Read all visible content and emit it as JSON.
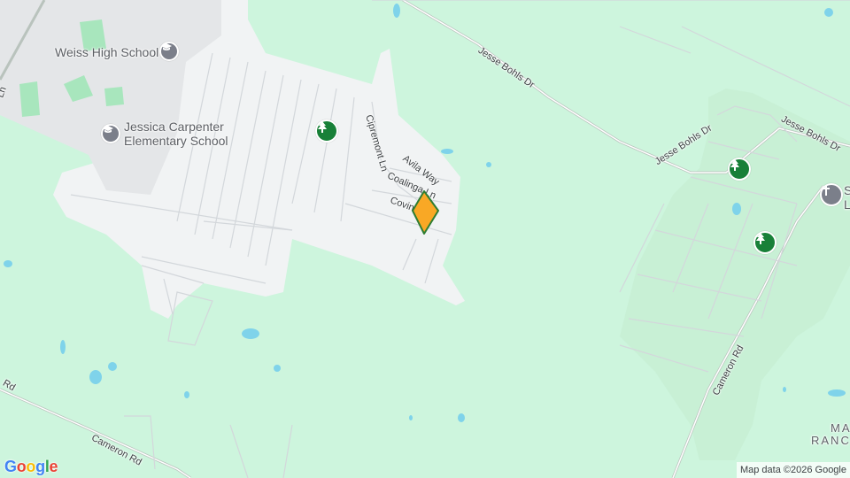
{
  "map": {
    "colors": {
      "land": "#cdf5dd",
      "urban": "#f1f3f4",
      "water": "#7fd3ea",
      "school": "#dadce0",
      "road": "#ffffff",
      "marker": "#f9a825"
    },
    "pois": {
      "weiss": "Weiss High School",
      "jessica_line1": "Jessica Carpenter",
      "jessica_line2": "Elementary School",
      "right_church": "S",
      "right_church2": "L"
    },
    "roads": {
      "jesse1": "Jesse Bohls Dr",
      "jesse2": "Jesse Bohls Dr",
      "jesse3": "Jesse Bohls Dr",
      "cipremont": "Cipremont Ln",
      "avila": "Avila Way",
      "coalinga": "Coalinga Ln",
      "covina": "Covin",
      "cameron1": "Cameron Rd",
      "cameron2": "Cameron Rd",
      "left_rd": "Rd",
      "left_ln": "Ln"
    },
    "places": {
      "manor_line1": "MA",
      "manor_line2": "RANCH"
    },
    "icons": [
      "school-icon",
      "park-icon",
      "church-icon",
      "map-pin-icon"
    ],
    "attribution": "Map data ©2026 Google",
    "logo": [
      "G",
      "o",
      "o",
      "g",
      "l",
      "e"
    ]
  }
}
